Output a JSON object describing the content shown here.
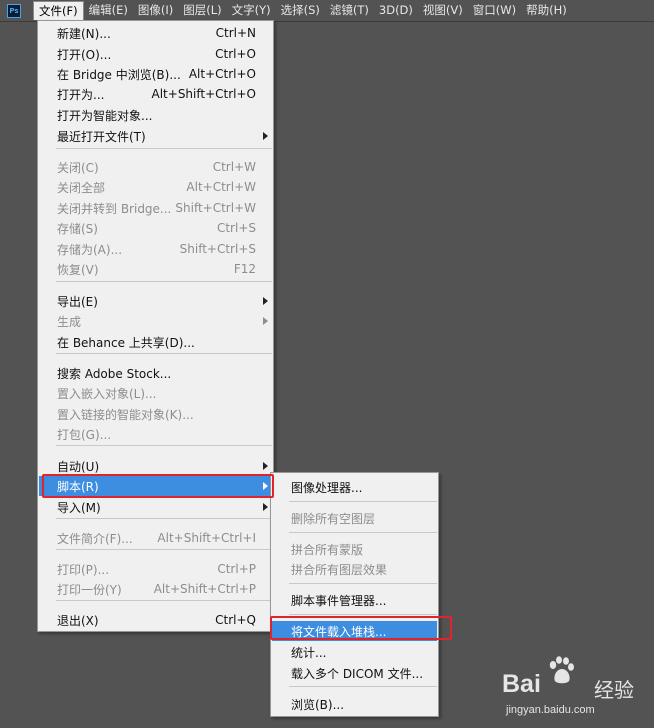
{
  "menubar": {
    "app_icon": "ps-logo-icon",
    "items": [
      "文件(F)",
      "编辑(E)",
      "图像(I)",
      "图层(L)",
      "文字(Y)",
      "选择(S)",
      "滤镜(T)",
      "3D(D)",
      "视图(V)",
      "窗口(W)",
      "帮助(H)"
    ]
  },
  "file_menu": [
    {
      "label": "新建(N)...",
      "shortcut": "Ctrl+N",
      "enabled": true
    },
    {
      "label": "打开(O)...",
      "shortcut": "Ctrl+O",
      "enabled": true
    },
    {
      "label": "在 Bridge 中浏览(B)...",
      "shortcut": "Alt+Ctrl+O",
      "enabled": true
    },
    {
      "label": "打开为...",
      "shortcut": "Alt+Shift+Ctrl+O",
      "enabled": true
    },
    {
      "label": "打开为智能对象...",
      "shortcut": "",
      "enabled": true
    },
    {
      "label": "最近打开文件(T)",
      "shortcut": "",
      "enabled": true,
      "submenu": true
    },
    {
      "label": "关闭(C)",
      "shortcut": "Ctrl+W",
      "enabled": false
    },
    {
      "label": "关闭全部",
      "shortcut": "Alt+Ctrl+W",
      "enabled": false
    },
    {
      "label": "关闭并转到 Bridge...",
      "shortcut": "Shift+Ctrl+W",
      "enabled": false
    },
    {
      "label": "存储(S)",
      "shortcut": "Ctrl+S",
      "enabled": false
    },
    {
      "label": "存储为(A)...",
      "shortcut": "Shift+Ctrl+S",
      "enabled": false
    },
    {
      "label": "恢复(V)",
      "shortcut": "F12",
      "enabled": false
    },
    {
      "label": "导出(E)",
      "shortcut": "",
      "enabled": true,
      "submenu": true
    },
    {
      "label": "生成",
      "shortcut": "",
      "enabled": false,
      "submenu": true
    },
    {
      "label": "在 Behance 上共享(D)...",
      "shortcut": "",
      "enabled": true
    },
    {
      "label": "搜索 Adobe Stock...",
      "shortcut": "",
      "enabled": true
    },
    {
      "label": "置入嵌入对象(L)...",
      "shortcut": "",
      "enabled": false
    },
    {
      "label": "置入链接的智能对象(K)...",
      "shortcut": "",
      "enabled": false
    },
    {
      "label": "打包(G)...",
      "shortcut": "",
      "enabled": false
    },
    {
      "label": "自动(U)",
      "shortcut": "",
      "enabled": true,
      "submenu": true
    },
    {
      "label": "脚本(R)",
      "shortcut": "",
      "enabled": true,
      "submenu": true,
      "highlighted": true
    },
    {
      "label": "导入(M)",
      "shortcut": "",
      "enabled": true,
      "submenu": true
    },
    {
      "label": "文件简介(F)...",
      "shortcut": "Alt+Shift+Ctrl+I",
      "enabled": false
    },
    {
      "label": "打印(P)...",
      "shortcut": "Ctrl+P",
      "enabled": false
    },
    {
      "label": "打印一份(Y)",
      "shortcut": "Alt+Shift+Ctrl+P",
      "enabled": false
    },
    {
      "label": "退出(X)",
      "shortcut": "Ctrl+Q",
      "enabled": true
    }
  ],
  "script_menu": [
    {
      "label": "图像处理器...",
      "enabled": true
    },
    {
      "label": "删除所有空图层",
      "enabled": false
    },
    {
      "label": "拼合所有蒙版",
      "enabled": false
    },
    {
      "label": "拼合所有图层效果",
      "enabled": false
    },
    {
      "label": "脚本事件管理器...",
      "enabled": true
    },
    {
      "label": "将文件载入堆栈...",
      "enabled": true,
      "highlighted": true
    },
    {
      "label": "统计...",
      "enabled": true
    },
    {
      "label": "载入多个 DICOM 文件...",
      "enabled": true
    },
    {
      "label": "浏览(B)...",
      "enabled": true
    }
  ],
  "watermark": {
    "brand": "Bai",
    "brand_cn": "经验",
    "url": "jingyan.baidu.com"
  },
  "colors": {
    "workspace": "#535353",
    "menu_bg": "#f0f0f0",
    "highlight": "#3d8ee0",
    "annotation_red": "#e0242b"
  }
}
